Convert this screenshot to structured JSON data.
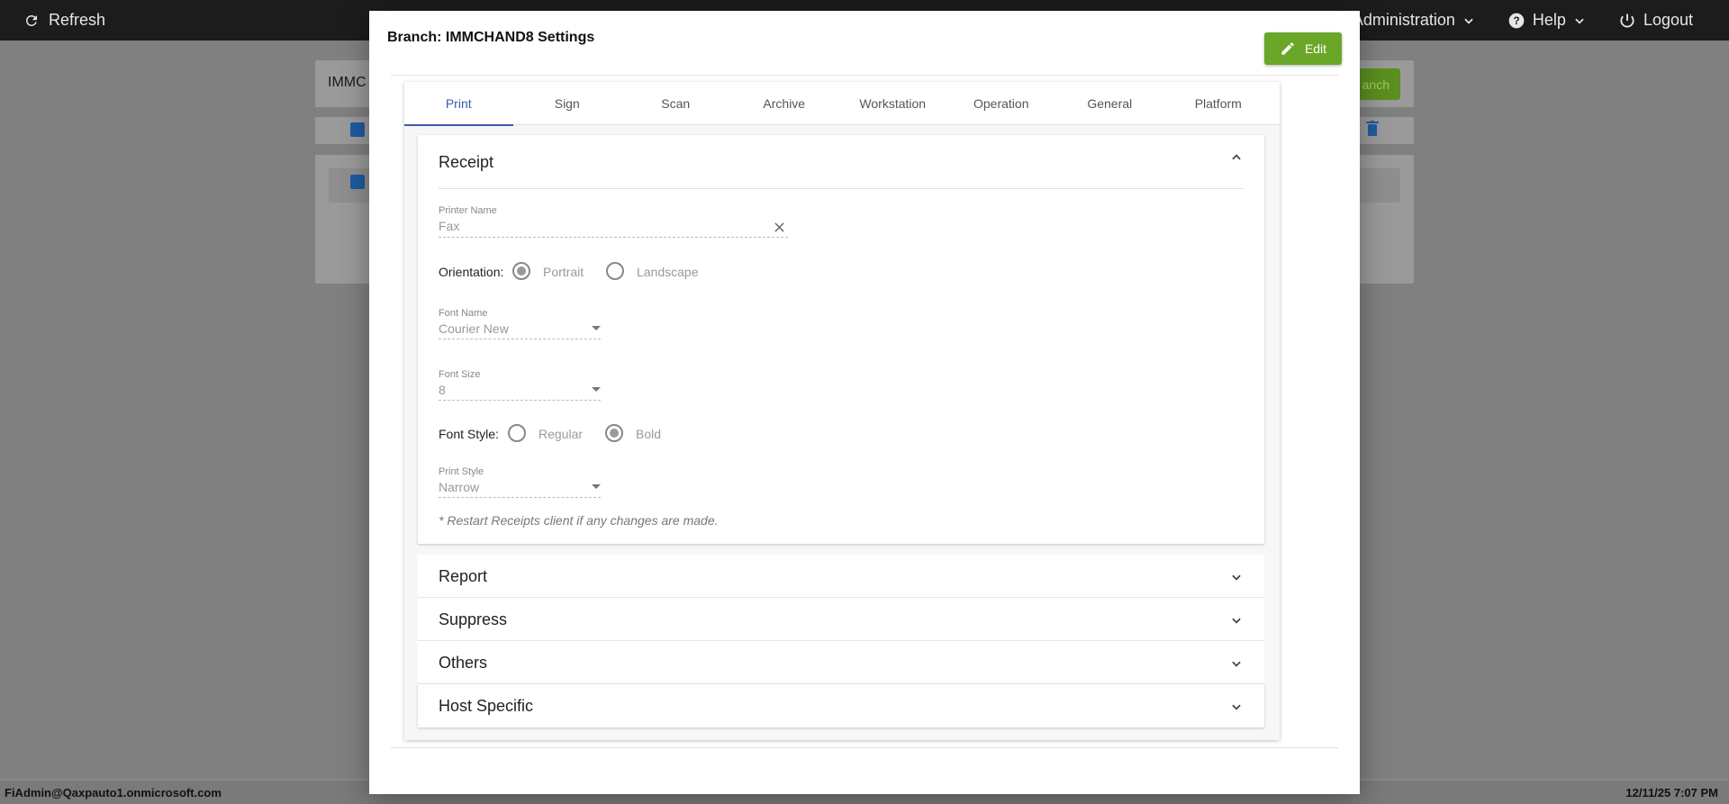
{
  "topbar": {
    "refresh_label": "Refresh",
    "administration_label": "Administration",
    "help_label": "Help",
    "logout_label": "Logout"
  },
  "background": {
    "search_text": "IMMC",
    "branch_btn_label": "anch"
  },
  "statusbar": {
    "user": "FiAdmin@Qaxpauto1.onmicrosoft.com",
    "datetime": "12/11/25 7:07 PM"
  },
  "modal": {
    "title": "Branch: IMMCHAND8 Settings",
    "edit_label": "Edit",
    "tabs": [
      {
        "label": "Print",
        "active": true
      },
      {
        "label": "Sign",
        "active": false
      },
      {
        "label": "Scan",
        "active": false
      },
      {
        "label": "Archive",
        "active": false
      },
      {
        "label": "Workstation",
        "active": false
      },
      {
        "label": "Operation",
        "active": false
      },
      {
        "label": "General",
        "active": false
      },
      {
        "label": "Platform",
        "active": false
      }
    ],
    "receipt": {
      "title": "Receipt",
      "printer_name_label": "Printer Name",
      "printer_name_value": "Fax",
      "orientation_label": "Orientation:",
      "orientation_options": [
        "Portrait",
        "Landscape"
      ],
      "orientation_selected": "Portrait",
      "font_name_label": "Font Name",
      "font_name_value": "Courier New",
      "font_size_label": "Font Size",
      "font_size_value": "8",
      "font_style_label": "Font Style:",
      "font_style_options": [
        "Regular",
        "Bold"
      ],
      "font_style_selected": "Bold",
      "print_style_label": "Print Style",
      "print_style_value": "Narrow",
      "note": "* Restart Receipts client if any changes are made."
    },
    "sections": [
      "Report",
      "Suppress",
      "Others",
      "Host Specific"
    ]
  },
  "colors": {
    "accent": "#3b5bb3",
    "edit_button": "#6aa628",
    "topbar": "#1c1c1c"
  }
}
